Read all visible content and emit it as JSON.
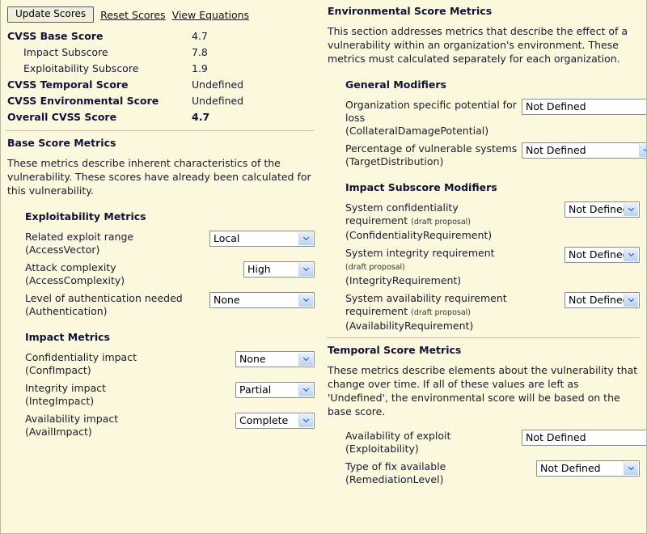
{
  "toolbar": {
    "update_button": "Update Scores",
    "reset_link": "Reset Scores",
    "equations_link": "View Equations"
  },
  "scores": [
    {
      "label": "CVSS Base Score",
      "value": "4.7",
      "style": "bold"
    },
    {
      "label": "Impact Subscore",
      "value": "7.8",
      "style": "sub"
    },
    {
      "label": "Exploitability Subscore",
      "value": "1.9",
      "style": "sub"
    },
    {
      "label": "CVSS Temporal Score",
      "value": "Undefined",
      "style": "bold"
    },
    {
      "label": "CVSS Environmental Score",
      "value": "Undefined",
      "style": "bold"
    },
    {
      "label": "Overall CVSS Score",
      "value": "4.7",
      "style": "bold-val"
    }
  ],
  "base": {
    "heading": "Base Score Metrics",
    "description": "These metrics describe inherent characteristics of the vulnerability. These scores have already been calculated for this vulnerability.",
    "exploitability_heading": "Exploitability Metrics",
    "exploitability_metrics": [
      {
        "label": "Related exploit range",
        "key": "(AccessVector)",
        "value": "Local"
      },
      {
        "label": "Attack complexity",
        "key": "(AccessComplexity)",
        "value": "High"
      },
      {
        "label": "Level of authentication needed",
        "key": "(Authentication)",
        "value": "None"
      }
    ],
    "impact_heading": "Impact Metrics",
    "impact_metrics": [
      {
        "label": "Confidentiality impact",
        "key": "(ConfImpact)",
        "value": "None"
      },
      {
        "label": "Integrity impact",
        "key": "(IntegImpact)",
        "value": "Partial"
      },
      {
        "label": "Availability impact",
        "key": "(AvailImpact)",
        "value": "Complete"
      }
    ]
  },
  "environmental": {
    "heading": "Environmental Score Metrics",
    "description": "This section addresses metrics that describe the effect of a vulnerability within an organization's environment. These metrics must calculated separately for each organization.",
    "general_heading": "General Modifiers",
    "general_metrics": [
      {
        "label": "Organization specific potential for loss",
        "key": "(CollateralDamagePotential)",
        "value": "Not Defined"
      },
      {
        "label": "Percentage of vulnerable systems",
        "key": "(TargetDistribution)",
        "value": "Not Defined"
      }
    ],
    "subscore_heading": "Impact Subscore Modifiers",
    "subscore_metrics": [
      {
        "label": "System confidentiality requirement",
        "note": "(draft proposal)",
        "key": "(ConfidentialityRequirement)",
        "value": "Not Defined"
      },
      {
        "label": "System integrity requirement",
        "note": "(draft proposal)",
        "key": "(IntegrityRequirement)",
        "value": "Not Defined"
      },
      {
        "label": "System availability requirement",
        "note": "(draft proposal)",
        "key": "(AvailabilityRequirement)",
        "value": "Not Defined"
      }
    ]
  },
  "temporal": {
    "heading": "Temporal Score Metrics",
    "description": "These metrics describe elements about the vulnerability that change over time. If all of these values are left as 'Undefined', the environmental score will be based on the base score.",
    "metrics": [
      {
        "label": "Availability of exploit",
        "key": "(Exploitability)",
        "value": "Not Defined"
      },
      {
        "label": "Type of fix available",
        "key": "(RemediationLevel)",
        "value": "Not Defined"
      }
    ]
  },
  "colors": {
    "background": "#fbf8dd",
    "heading": "#121237",
    "divider": "#c9c5a8",
    "select_arrow": "#2c5a9e"
  }
}
